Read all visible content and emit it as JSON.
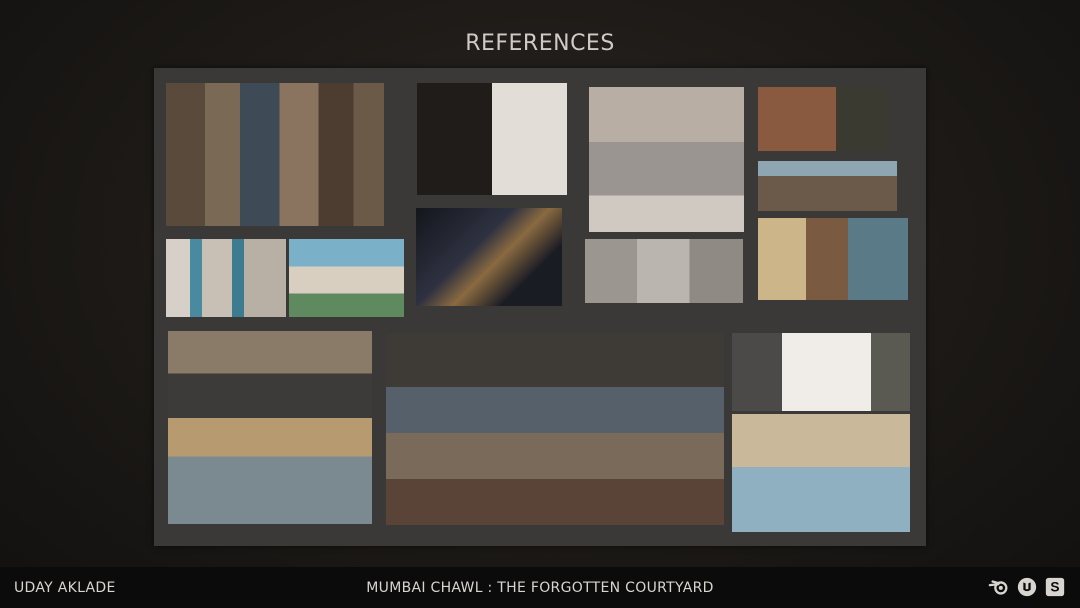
{
  "slide": {
    "title": "REFERENCES",
    "author": "UDAY AKLADE",
    "project": "MUMBAI CHAWL : THE FORGOTTEN COURTYARD"
  },
  "logos": [
    "blender-icon",
    "unreal-icon",
    "substance-icon"
  ],
  "palette": {
    "board": "#3a3937",
    "footer": "#0b0b0b",
    "text": "#d8d5d0"
  }
}
